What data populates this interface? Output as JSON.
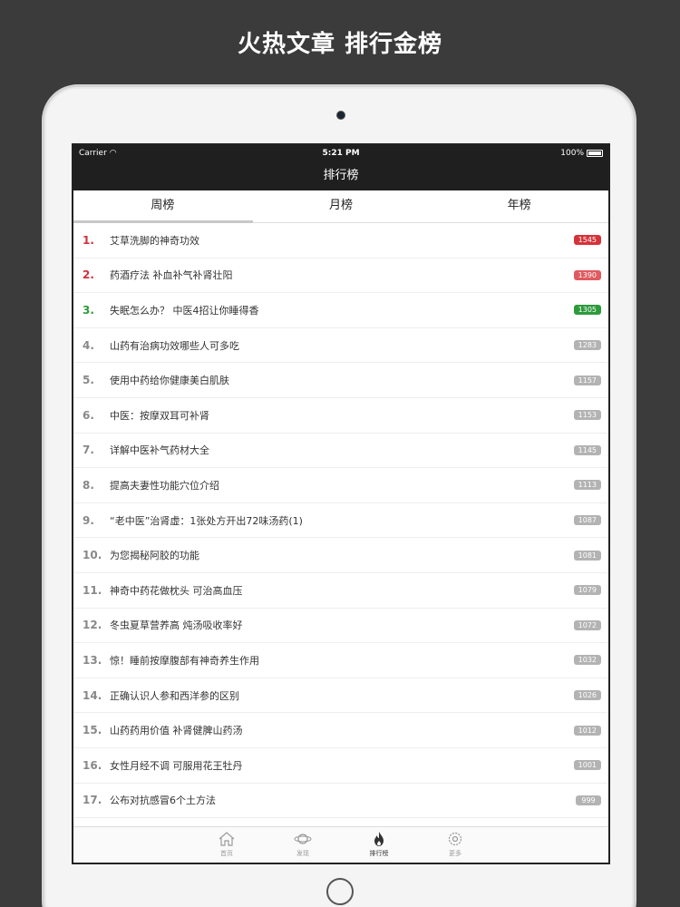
{
  "headline": "火热文章 排行金榜",
  "status_bar": {
    "carrier": "Carrier",
    "time": "5:21 PM",
    "battery": "100%"
  },
  "nav": {
    "title": "排行榜"
  },
  "tabs": [
    {
      "label": "周榜",
      "active": true
    },
    {
      "label": "月榜",
      "active": false
    },
    {
      "label": "年榜",
      "active": false
    }
  ],
  "articles": [
    {
      "rank": "1.",
      "title": "艾草洗脚的神奇功效",
      "count": "1545"
    },
    {
      "rank": "2.",
      "title": "药酒疗法 补血补气补肾壮阳",
      "count": "1390"
    },
    {
      "rank": "3.",
      "title": "失眠怎么办？ 中医4招让你睡得香",
      "count": "1305"
    },
    {
      "rank": "4.",
      "title": "山药有治病功效哪些人可多吃",
      "count": "1283"
    },
    {
      "rank": "5.",
      "title": "使用中药给你健康美白肌肤",
      "count": "1157"
    },
    {
      "rank": "6.",
      "title": "中医：按摩双耳可补肾",
      "count": "1153"
    },
    {
      "rank": "7.",
      "title": "详解中医补气药材大全",
      "count": "1145"
    },
    {
      "rank": "8.",
      "title": "提高夫妻性功能穴位介绍",
      "count": "1113"
    },
    {
      "rank": "9.",
      "title": "“老中医”治肾虚：1张处方开出72味汤药(1)",
      "count": "1087"
    },
    {
      "rank": "10.",
      "title": "为您揭秘阿胶的功能",
      "count": "1081"
    },
    {
      "rank": "11.",
      "title": "神奇中药花做枕头 可治高血压",
      "count": "1079"
    },
    {
      "rank": "12.",
      "title": "冬虫夏草营养高 炖汤吸收率好",
      "count": "1072"
    },
    {
      "rank": "13.",
      "title": "惊！睡前按摩腹部有神奇养生作用",
      "count": "1032"
    },
    {
      "rank": "14.",
      "title": "正确认识人参和西洋参的区别",
      "count": "1026"
    },
    {
      "rank": "15.",
      "title": "山药药用价值 补肾健脾山药汤",
      "count": "1012"
    },
    {
      "rank": "16.",
      "title": "女性月经不调 可服用花王牡丹",
      "count": "1001"
    },
    {
      "rank": "17.",
      "title": "公布对抗感冒6个土方法",
      "count": "999"
    }
  ],
  "tab_bar": [
    {
      "label": "首页",
      "icon": "home-icon",
      "active": false
    },
    {
      "label": "发现",
      "icon": "planet-icon",
      "active": false
    },
    {
      "label": "排行榜",
      "icon": "flame-icon",
      "active": true
    },
    {
      "label": "更多",
      "icon": "gear-icon",
      "active": false
    }
  ],
  "colors": {
    "rank_red": "#d0303a",
    "rank_green": "#2e9a3a",
    "badge_gray": "#b3b3b3"
  }
}
